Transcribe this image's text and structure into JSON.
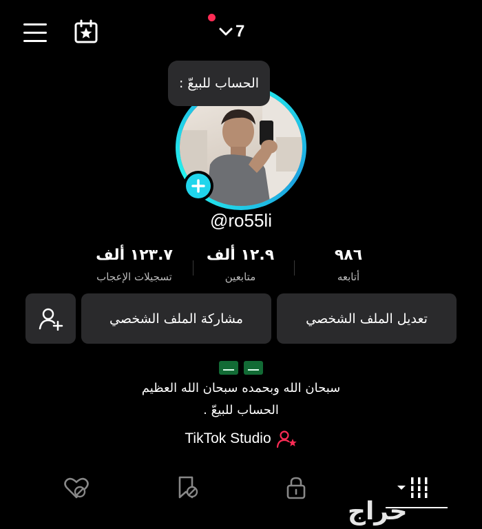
{
  "top_bar": {
    "account_count": "7"
  },
  "tooltip": {
    "text": "الحساب للبيعّ :"
  },
  "profile": {
    "username": "@ro55li"
  },
  "stats": [
    {
      "value": "٩٨٦",
      "label": "أتابعه"
    },
    {
      "value": "١٢.٩ ألف",
      "label": "متابعين"
    },
    {
      "value": "١٢٣.٧ ألف",
      "label": "تسجيلات الإعجاب"
    }
  ],
  "buttons": {
    "edit_profile": "تعديل الملف الشخصي",
    "share_profile": "مشاركة الملف الشخصي"
  },
  "bio": {
    "line1": "سبحان الله وبحمده سبحان الله العظيم",
    "line2": "الحساب للبيعّ ."
  },
  "studio": {
    "label": "TikTok Studio"
  },
  "watermark": {
    "text": "حراج"
  },
  "colors": {
    "accent_ring": "#25f4ee",
    "notification": "#fe2c55",
    "button_bg": "#2a2a2c"
  }
}
